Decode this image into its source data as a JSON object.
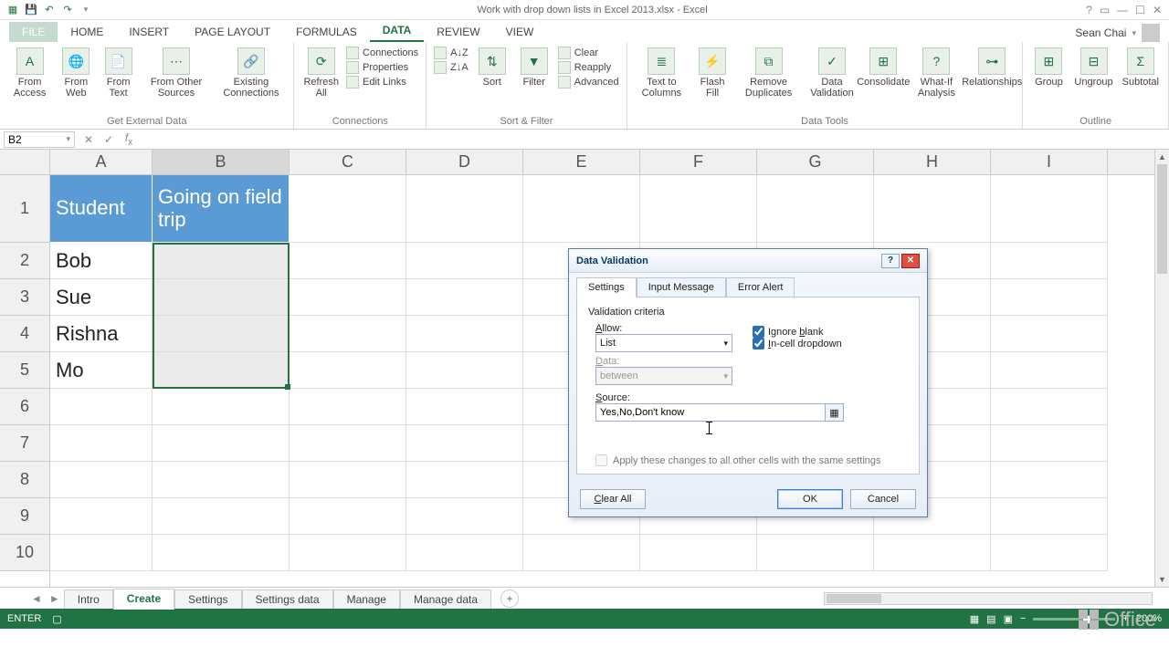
{
  "title": "Work with drop down lists in Excel 2013.xlsx - Excel",
  "user": "Sean Chai",
  "tabs": [
    "HOME",
    "INSERT",
    "PAGE LAYOUT",
    "FORMULAS",
    "DATA",
    "REVIEW",
    "VIEW"
  ],
  "active_tab": "DATA",
  "ribbon": {
    "groups": [
      {
        "label": "Get External Data",
        "big": [
          "From Access",
          "From Web",
          "From Text",
          "From Other Sources",
          "Existing Connections"
        ]
      },
      {
        "label": "Connections",
        "big": [
          "Refresh All"
        ],
        "mini": [
          "Connections",
          "Properties",
          "Edit Links"
        ]
      },
      {
        "label": "Sort & Filter",
        "big": [
          "Sort",
          "Filter"
        ],
        "mini": [
          "Clear",
          "Reapply",
          "Advanced"
        ],
        "extra": [
          "A↓Z",
          "Z↓A"
        ]
      },
      {
        "label": "Data Tools",
        "big": [
          "Text to Columns",
          "Flash Fill",
          "Remove Duplicates",
          "Data Validation",
          "Consolidate",
          "What-If Analysis",
          "Relationships"
        ]
      },
      {
        "label": "Outline",
        "big": [
          "Group",
          "Ungroup",
          "Subtotal"
        ]
      }
    ]
  },
  "namebox": "B2",
  "formula": "",
  "columns": [
    "A",
    "B",
    "C",
    "D",
    "E",
    "F",
    "G",
    "H",
    "I"
  ],
  "rows_shown": 10,
  "header_row": {
    "A": "Student",
    "B": "Going on field trip"
  },
  "data_rows": [
    {
      "A": "Bob",
      "B": ""
    },
    {
      "A": "Sue",
      "B": ""
    },
    {
      "A": "Rishna",
      "B": ""
    },
    {
      "A": "Mo",
      "B": ""
    }
  ],
  "sheet_tabs": [
    "Intro",
    "Create",
    "Settings",
    "Settings data",
    "Manage",
    "Manage data"
  ],
  "active_sheet": "Create",
  "status_mode": "ENTER",
  "zoom": "200%",
  "dialog": {
    "title": "Data Validation",
    "tabs": [
      "Settings",
      "Input Message",
      "Error Alert"
    ],
    "active_tab": "Settings",
    "criteria_label": "Validation criteria",
    "allow_label": "Allow:",
    "allow_value": "List",
    "data_label": "Data:",
    "data_value": "between",
    "ignore_blank_label": "Ignore blank",
    "ignore_blank": true,
    "incell_label": "In-cell dropdown",
    "incell": true,
    "source_label": "Source:",
    "source_value": "Yes,No,Don't know",
    "apply_label": "Apply these changes to all other cells with the same settings",
    "apply": false,
    "clear_label": "Clear All",
    "ok_label": "OK",
    "cancel_label": "Cancel"
  },
  "office_brand": "Office"
}
